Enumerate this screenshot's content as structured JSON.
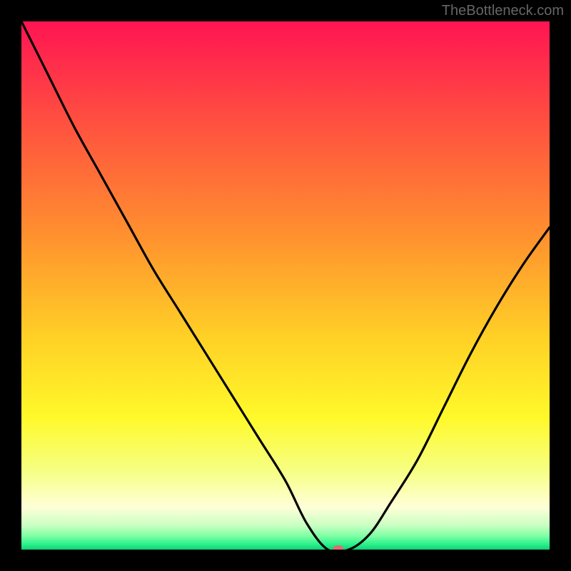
{
  "watermark": "TheBottleneck.com",
  "chart_data": {
    "type": "line",
    "title": "",
    "xlabel": "",
    "ylabel": "",
    "xlim": [
      0,
      1
    ],
    "ylim": [
      0,
      1
    ],
    "curve": {
      "x": [
        0.0,
        0.05,
        0.1,
        0.15,
        0.2,
        0.25,
        0.3,
        0.35,
        0.4,
        0.45,
        0.5,
        0.54,
        0.58,
        0.62,
        0.66,
        0.7,
        0.75,
        0.8,
        0.85,
        0.9,
        0.95,
        1.0
      ],
      "y": [
        1.0,
        0.9,
        0.8,
        0.71,
        0.62,
        0.53,
        0.45,
        0.37,
        0.29,
        0.21,
        0.13,
        0.05,
        0.0,
        0.0,
        0.03,
        0.09,
        0.17,
        0.27,
        0.37,
        0.46,
        0.54,
        0.61
      ]
    },
    "marker": {
      "x": 0.6,
      "y": 0.0,
      "color": "#d9706f"
    },
    "gradient_stops": [
      {
        "offset": 0.0,
        "color": "#ff1452"
      },
      {
        "offset": 0.2,
        "color": "#ff533f"
      },
      {
        "offset": 0.4,
        "color": "#ff8f2f"
      },
      {
        "offset": 0.6,
        "color": "#ffd126"
      },
      {
        "offset": 0.75,
        "color": "#fff92a"
      },
      {
        "offset": 0.85,
        "color": "#f6ff82"
      },
      {
        "offset": 0.92,
        "color": "#ffffd8"
      },
      {
        "offset": 0.955,
        "color": "#c8ffc1"
      },
      {
        "offset": 0.975,
        "color": "#7bffa3"
      },
      {
        "offset": 0.99,
        "color": "#29f18c"
      },
      {
        "offset": 1.0,
        "color": "#13cf74"
      }
    ]
  }
}
